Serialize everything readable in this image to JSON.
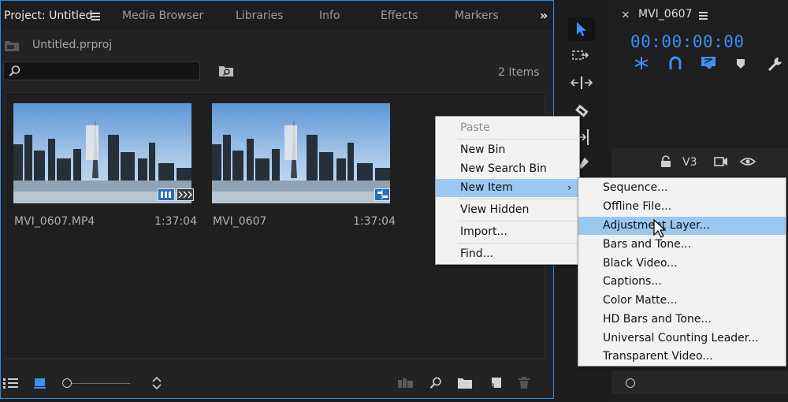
{
  "project_panel": {
    "tabs": [
      {
        "label": "Project: Untitled"
      },
      {
        "label": "Media Browser"
      },
      {
        "label": "Libraries"
      },
      {
        "label": "Info"
      },
      {
        "label": "Effects"
      },
      {
        "label": "Markers"
      }
    ],
    "overflow_icon": "double-chevron-right-icon",
    "file_name": "Untitled.prproj",
    "item_count": "2 Items",
    "search_value": "",
    "clips": [
      {
        "name": "MVI_0607.MP4",
        "duration": "1:37:04",
        "badge": "video-audio-badge-icon"
      },
      {
        "name": "MVI_0607",
        "duration": "1:37:04",
        "badge": "sequence-badge-icon"
      }
    ],
    "bottom_icons": [
      "list-view-icon",
      "icon-view-icon",
      "zoom-slider",
      "sort-icon",
      "automate-to-sequence-icon",
      "find-icon",
      "new-bin-icon",
      "new-item-icon",
      "clear-icon"
    ]
  },
  "toolbar": {
    "tools": [
      "selection-tool-icon",
      "track-select-tool-icon",
      "ripple-edit-tool-icon",
      "razor-tool-icon",
      "slip-tool-icon",
      "pen-tool-icon"
    ]
  },
  "program_panel": {
    "title": "MVI_0607",
    "timecode": "00:00:00:00",
    "track_label": "V3",
    "tool_icons": [
      "snap-icon",
      "linked-selection-icon",
      "add-marker-icon",
      "marker-icon",
      "wrench-icon"
    ]
  },
  "context_menu": {
    "items": [
      {
        "label": "Paste",
        "disabled": true
      },
      {
        "label": "New Bin"
      },
      {
        "label": "New Search Bin"
      },
      {
        "label": "New Item",
        "highlighted": true,
        "has_submenu": true
      },
      {
        "label": "View Hidden"
      },
      {
        "label": "Import..."
      },
      {
        "label": "Find..."
      }
    ]
  },
  "submenu": {
    "items": [
      {
        "label": "Sequence..."
      },
      {
        "label": "Offline File..."
      },
      {
        "label": "Adjustment Layer...",
        "highlighted": true
      },
      {
        "label": "Bars and Tone..."
      },
      {
        "label": "Black Video..."
      },
      {
        "label": "Captions..."
      },
      {
        "label": "Color Matte..."
      },
      {
        "label": "HD Bars and Tone..."
      },
      {
        "label": "Universal Counting Leader..."
      },
      {
        "label": "Transparent Video..."
      }
    ]
  },
  "colors": {
    "accent_blue": "#2d8ceb",
    "timecode_blue": "#3d8ef5",
    "menu_highlight": "#9ac8f0"
  }
}
